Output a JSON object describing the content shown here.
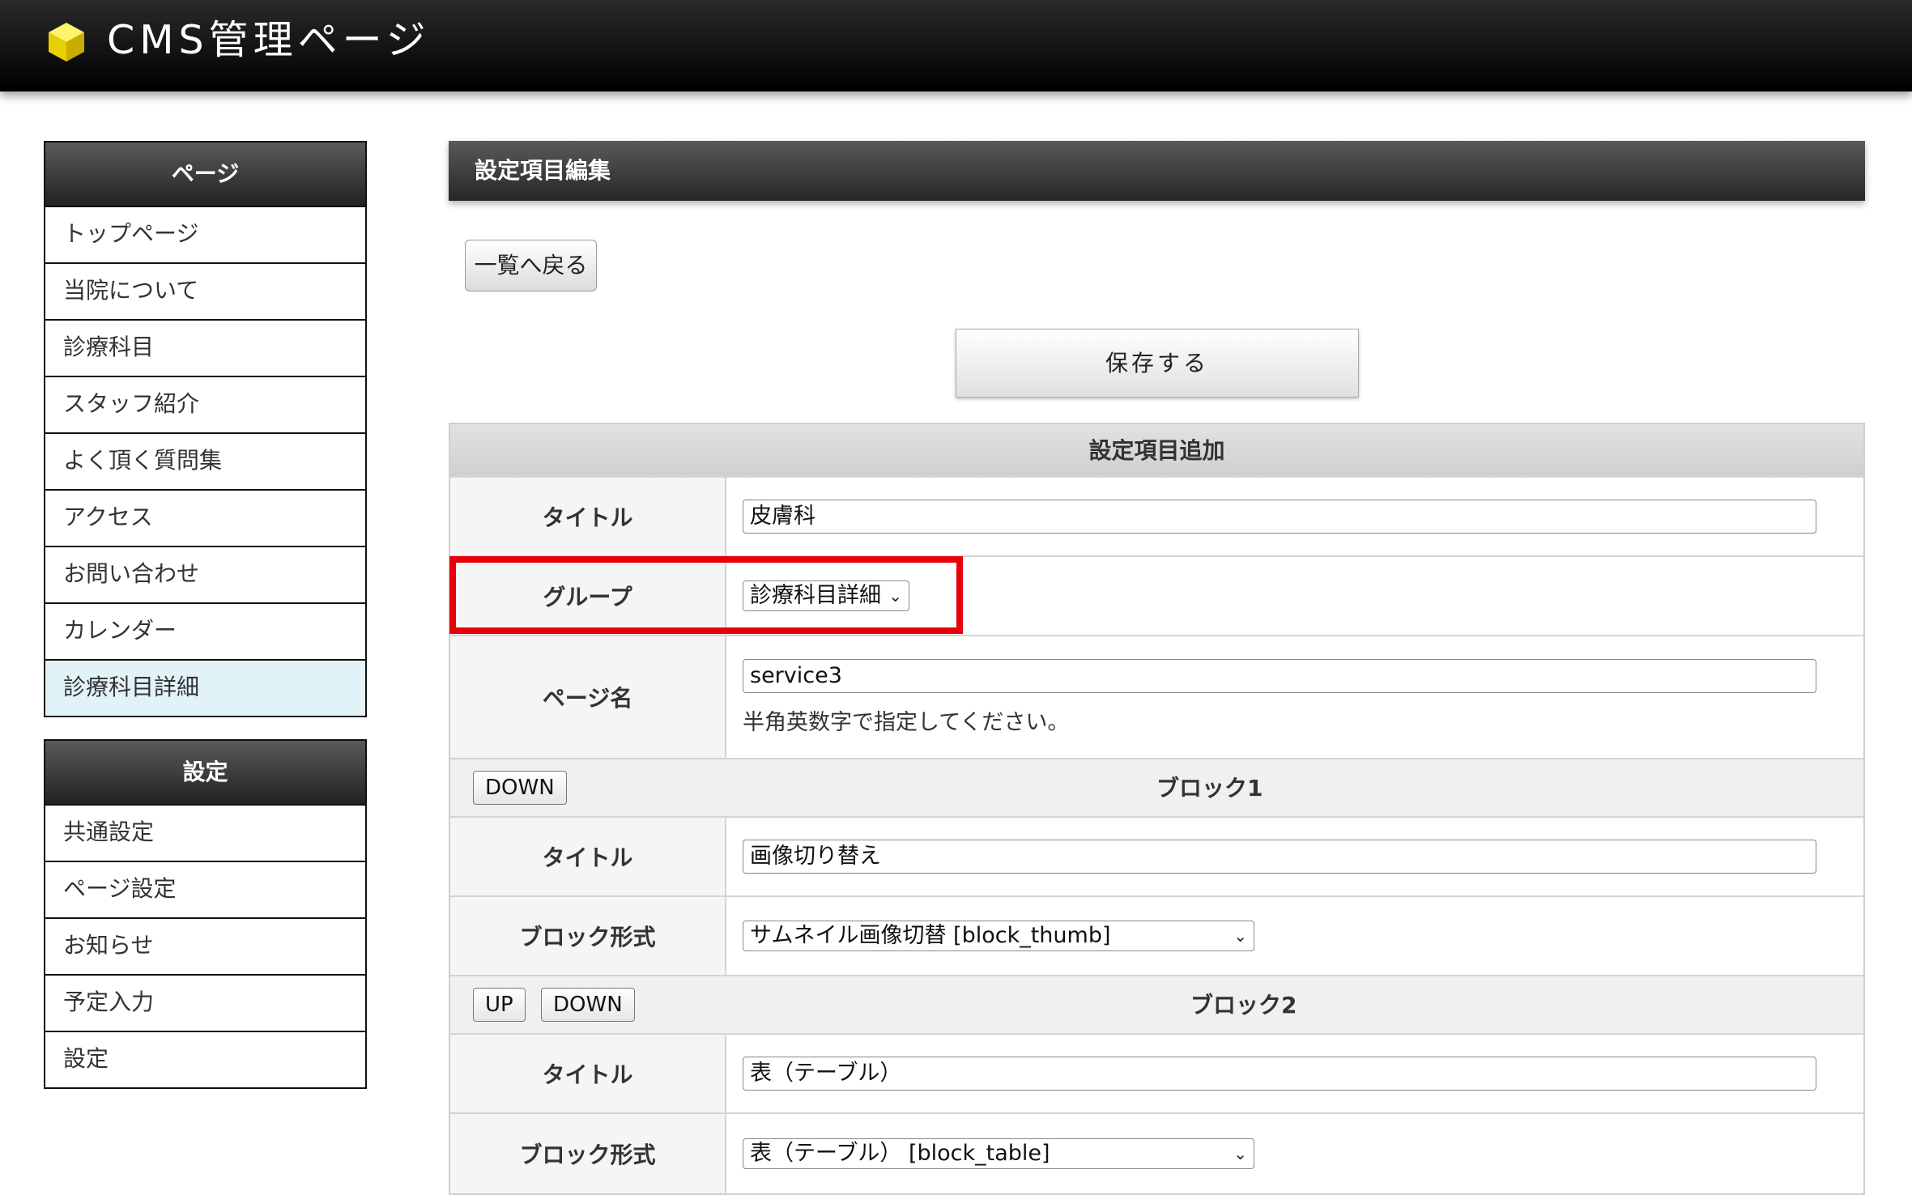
{
  "header": {
    "title": "CMS管理ページ",
    "logo_color": "#f0d800"
  },
  "sidebar": {
    "pages": {
      "heading": "ページ",
      "items": [
        "トップページ",
        "当院について",
        "診療科目",
        "スタッフ紹介",
        "よく頂く質問集",
        "アクセス",
        "お問い合わせ",
        "カレンダー",
        "診療科目詳細"
      ],
      "active_index": 8
    },
    "settings": {
      "heading": "設定",
      "items": [
        "共通設定",
        "ページ設定",
        "お知らせ",
        "予定入力",
        "設定"
      ]
    }
  },
  "main": {
    "heading": "設定項目編集",
    "back_button": "一覧へ戻る",
    "save_button": "保存する",
    "form": {
      "section_title": "設定項目追加",
      "title_label": "タイトル",
      "title_value": "皮膚科",
      "group_label": "グループ",
      "group_value": "診療科目詳細",
      "page_name_label": "ページ名",
      "page_name_value": "service3",
      "page_name_hint": "半角英数字で指定してください。",
      "blocks": [
        {
          "name": "ブロック1",
          "down_label": "DOWN",
          "title_label": "タイトル",
          "title_value": "画像切り替え",
          "type_label": "ブロック形式",
          "type_value": "サムネイル画像切替 [block_thumb]"
        },
        {
          "name": "ブロック2",
          "up_label": "UP",
          "down_label": "DOWN",
          "title_label": "タイトル",
          "title_value": "表（テーブル）",
          "type_label": "ブロック形式",
          "type_value": "表（テーブル） [block_table]"
        }
      ]
    }
  },
  "colors": {
    "highlight": "#e8000b",
    "active_item_bg": "#e2f3f8"
  }
}
